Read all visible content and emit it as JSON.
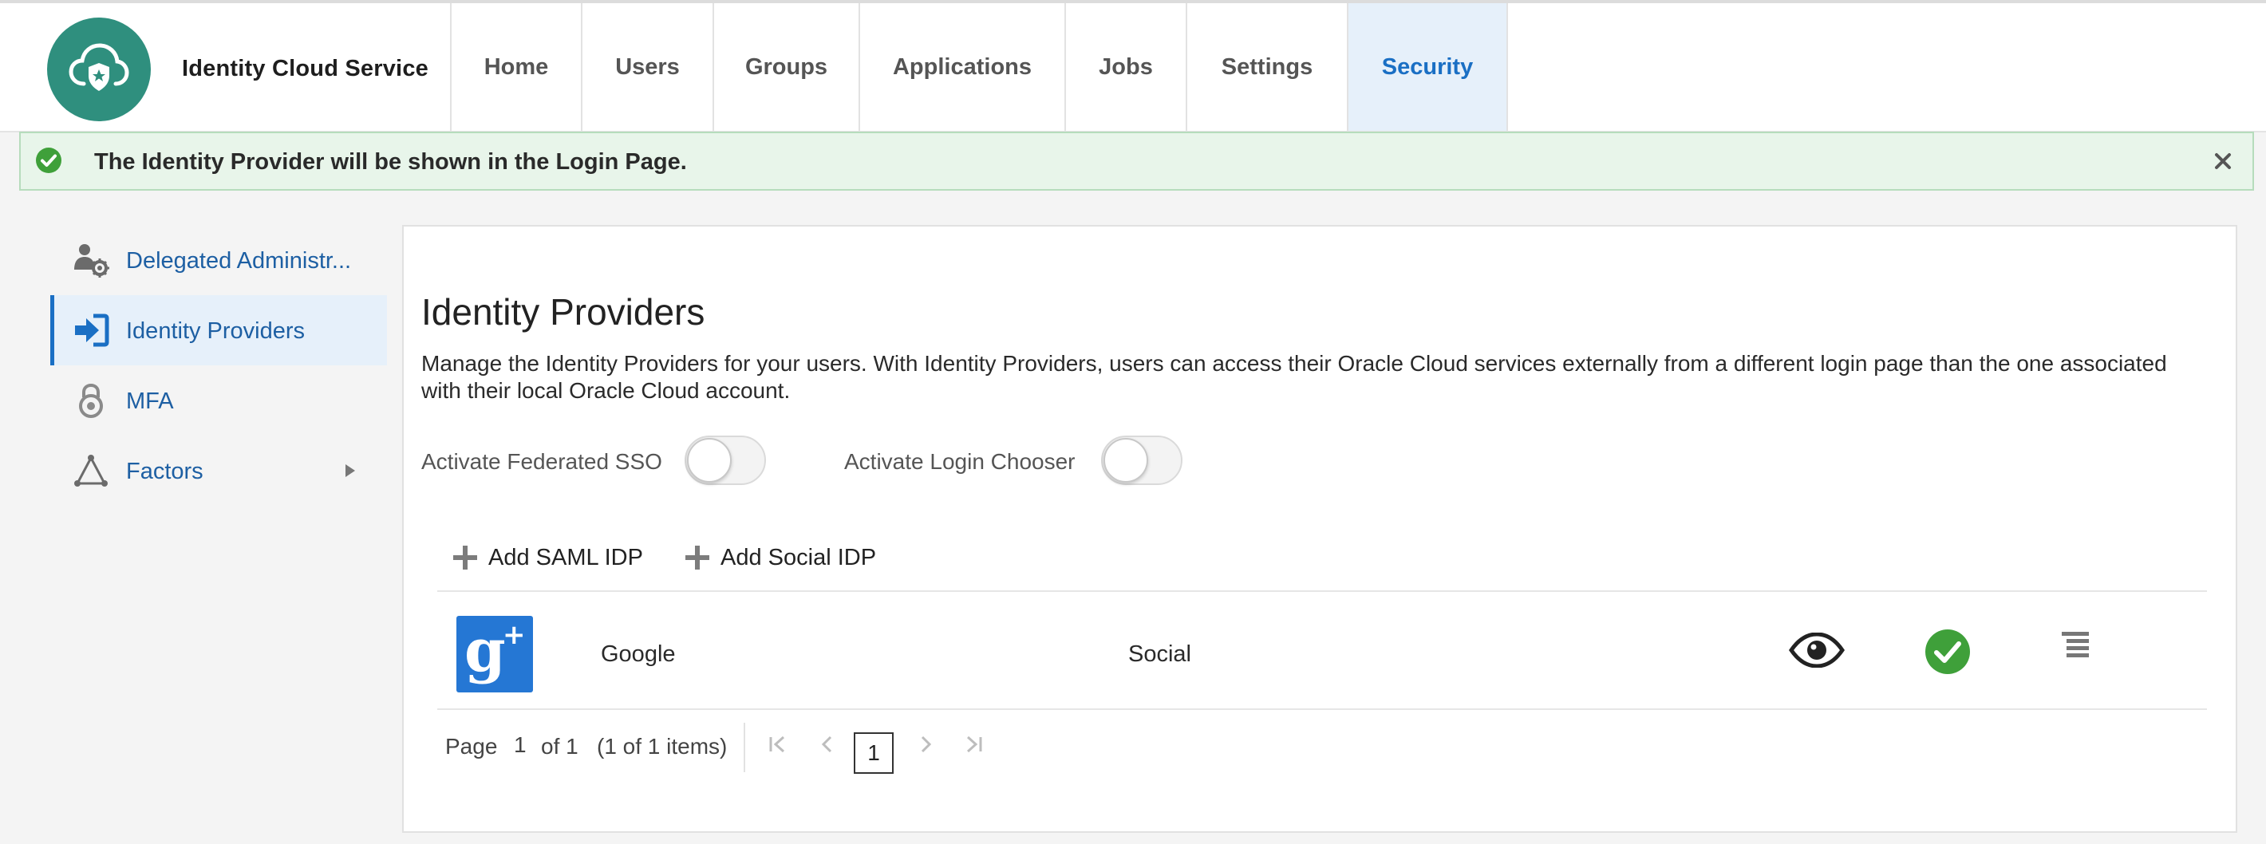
{
  "header": {
    "app_title": "Identity Cloud Service",
    "tabs": [
      {
        "label": "Home"
      },
      {
        "label": "Users"
      },
      {
        "label": "Groups"
      },
      {
        "label": "Applications"
      },
      {
        "label": "Jobs"
      },
      {
        "label": "Settings"
      },
      {
        "label": "Security",
        "active": true
      }
    ]
  },
  "banner": {
    "message": "The Identity Provider will be shown in the Login Page.",
    "icon": "check-circle-icon",
    "close_icon": "close-icon"
  },
  "sidebar": {
    "items": [
      {
        "label": "Delegated Administr...",
        "icon": "admin-gear-icon"
      },
      {
        "label": "Identity Providers",
        "icon": "sign-in-arrow-icon",
        "active": true
      },
      {
        "label": "MFA",
        "icon": "lock-icon"
      },
      {
        "label": "Factors",
        "icon": "triangle-nodes-icon",
        "has_submenu": true
      }
    ]
  },
  "main": {
    "title": "Identity Providers",
    "description": "Manage the Identity Providers for your users. With Identity Providers, users can access their Oracle Cloud services externally from a different login page than the one associated with their local Oracle Cloud account.",
    "toggles": [
      {
        "label": "Activate Federated SSO",
        "on": false
      },
      {
        "label": "Activate Login Chooser",
        "on": false
      }
    ],
    "toolbar": {
      "add_saml_label": "Add SAML IDP",
      "add_social_label": "Add Social IDP"
    },
    "table": {
      "rows": [
        {
          "logo_text": "g",
          "logo_sup": "+",
          "name": "Google",
          "type": "Social",
          "icons": [
            "eye-icon",
            "check-circle-icon",
            "menu-icon"
          ]
        }
      ]
    },
    "pagination": {
      "page_word": "Page",
      "current_page": "1",
      "of_text": "of 1",
      "items_text": "(1 of 1 items)",
      "page_box": "1"
    }
  },
  "colors": {
    "brand_teal": "#2f8f7e",
    "active_blue": "#1a6fc4",
    "active_bg": "#e6f0fa",
    "success_green": "#3fa03a",
    "banner_bg": "#e8f5ea",
    "google_blue": "#2577d4"
  }
}
